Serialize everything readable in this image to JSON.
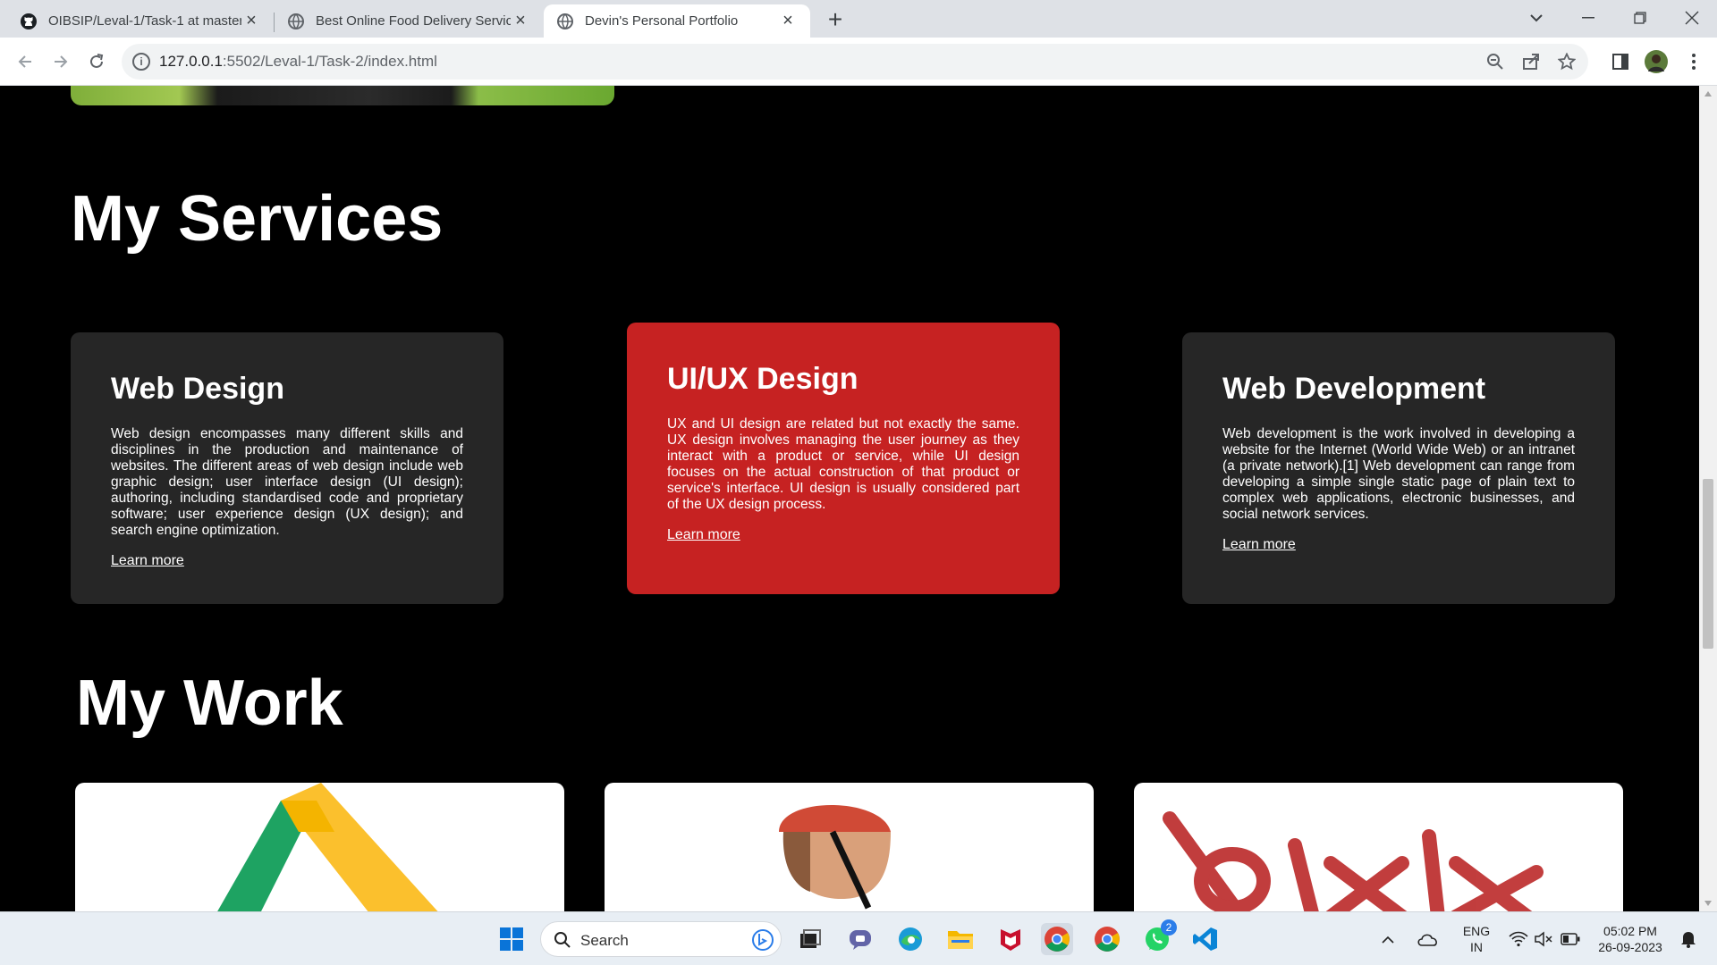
{
  "browser": {
    "tabs": [
      {
        "title": "OIBSIP/Leval-1/Task-1 at master",
        "icon": "github-icon",
        "active": false
      },
      {
        "title": "Best Online Food Delivery Servic",
        "icon": "globe-icon",
        "active": false
      },
      {
        "title": "Devin's Personal Portfolio",
        "icon": "globe-icon",
        "active": true
      }
    ],
    "url_host": "127.0.0.1",
    "url_path": ":5502/Leval-1/Task-2/index.html"
  },
  "page": {
    "services": {
      "title": "My Services",
      "cards": [
        {
          "title": "Web Design",
          "text": "Web design encompasses many different skills and disciplines in the production and maintenance of websites. The different areas of web design include web graphic design; user interface design (UI design); authoring, including standardised code and proprietary software; user experience design (UX design); and search engine optimization.",
          "link": "Learn more"
        },
        {
          "title": "UI/UX Design",
          "text": "UX and UI design are related but not exactly the same. UX design involves managing the user journey as they interact with a product or service, while UI design focuses on the actual construction of that product or service's interface. UI design is usually considered part of the UX design process.",
          "link": "Learn more"
        },
        {
          "title": "Web Development",
          "text": "Web development is the work involved in developing a website for the Internet (World Wide Web) or an intranet (a private network).[1] Web development can range from developing a simple single static page of plain text to complex web applications, electronic businesses, and social network services.",
          "link": "Learn more"
        }
      ]
    },
    "work": {
      "title": "My Work"
    }
  },
  "taskbar": {
    "search_placeholder": "Search",
    "lang_line1": "ENG",
    "lang_line2": "IN",
    "time": "05:02 PM",
    "date": "26-09-2023",
    "whatsapp_badge": "2"
  },
  "colors": {
    "accent": "#c62222",
    "card": "#262626",
    "background": "#000000"
  }
}
